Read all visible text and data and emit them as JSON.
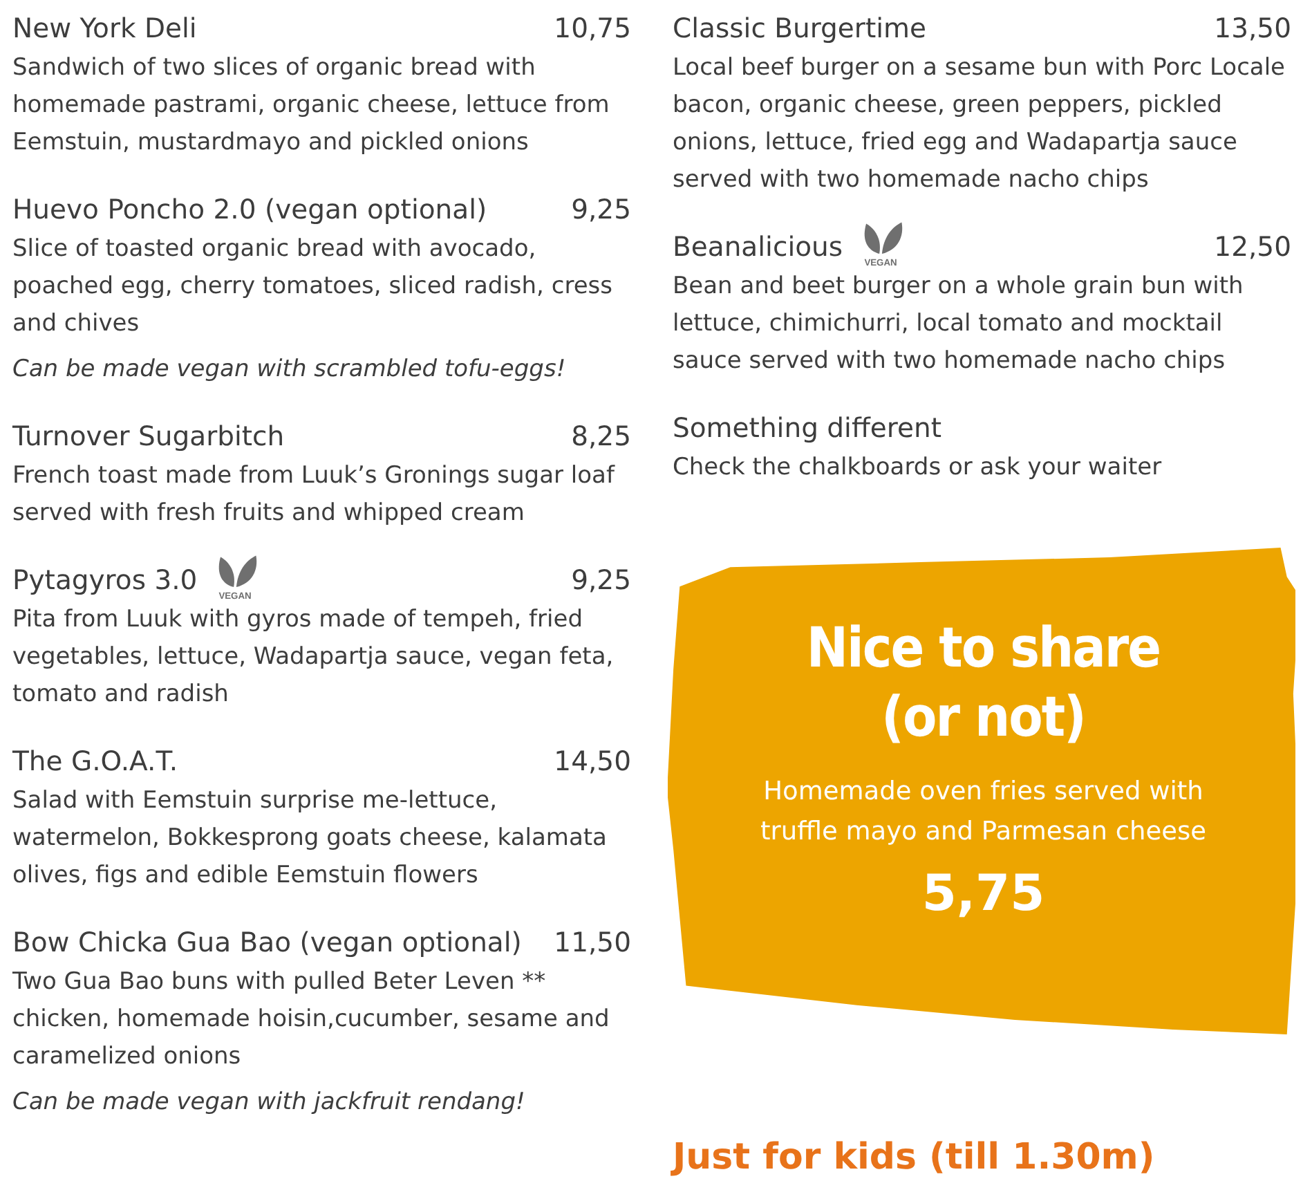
{
  "columns": [
    {
      "items": [
        {
          "name": "New York Deli",
          "price": "10,75",
          "vegan": false,
          "description": "Sandwich of two slices of organic bread with homemade pastrami, organic cheese, lettuce from Eemstuin, mustardmayo and pickled onions"
        },
        {
          "name": "Huevo Poncho 2.0 (vegan optional)",
          "price": "9,25",
          "vegan": false,
          "description": "Slice of toasted organic bread with avocado, poached egg, cherry tomatoes, sliced radish, cress and chives",
          "note": "Can be made vegan with scrambled tofu-eggs!"
        },
        {
          "name": "Turnover Sugarbitch",
          "price": "8,25",
          "vegan": false,
          "description": "French toast made from Luuk’s Gronings sugar loaf served with fresh fruits and whipped cream"
        },
        {
          "name": "Pytagyros 3.0",
          "price": "9,25",
          "vegan": true,
          "icon_label": "VEGAN",
          "description": "Pita from Luuk with gyros made of tempeh, fried vegetables, lettuce, Wadapartja sauce, vegan feta, tomato and radish"
        },
        {
          "name": "The G.O.A.T.",
          "price": "14,50",
          "vegan": false,
          "description": "Salad with Eemstuin surprise me-lettuce, watermelon, Bokkesprong goats cheese, kalamata olives, figs and edible Eemstuin flowers"
        },
        {
          "name": "Bow Chicka Gua Bao (vegan optional)",
          "price": "11,50",
          "vegan": false,
          "description": "Two Gua Bao buns with pulled Beter Leven ** chicken, homemade hoisin,cucumber, sesame and caramelized onions",
          "note": "Can be made vegan with jackfruit rendang!"
        }
      ]
    },
    {
      "items": [
        {
          "name": "Classic Burgertime",
          "price": "13,50",
          "vegan": false,
          "description": "Local beef burger on a sesame bun with Porc Locale bacon, organic cheese, green peppers, pickled onions, lettuce, fried egg and Wadapartja sauce served with two homemade nacho chips"
        },
        {
          "name": "Beanalicious",
          "price": "12,50",
          "vegan": true,
          "icon_label": "VEGAN",
          "description": "Bean and beet burger on a whole grain bun with lettuce, chimichurri, local tomato and mocktail sauce served with two homemade nacho chips"
        },
        {
          "name": "Something different",
          "vegan": false,
          "description": "Check the chalkboards or ask your waiter"
        }
      ]
    }
  ],
  "share_card": {
    "title_lines": [
      "Nice to share",
      "(or not)"
    ],
    "description": "Homemade oven fries served with truffle mayo and Parmesan cheese",
    "price": "5,75"
  },
  "kids_heading": "Just for kids (till 1.30m)"
}
